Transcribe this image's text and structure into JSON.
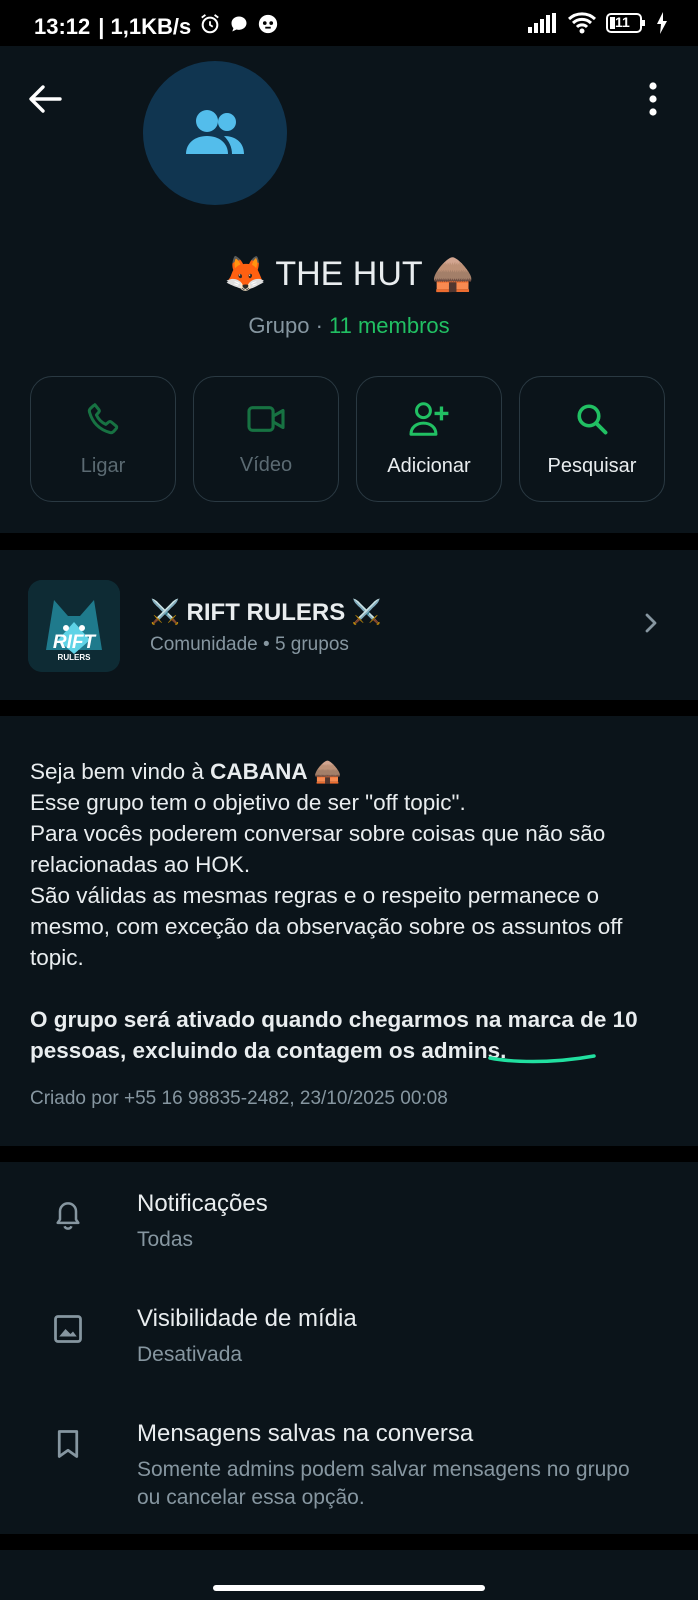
{
  "status_bar": {
    "time": "13:12",
    "speed": "| 1,1KB/s",
    "battery": "11"
  },
  "header": {
    "back_icon": "arrow-left-icon",
    "menu_icon": "more-vertical-icon",
    "avatar_icon": "group-people-icon",
    "title": "🦊 THE HUT 🛖",
    "subtitle_prefix": "Grupo · ",
    "members": "11 membros"
  },
  "actions": [
    {
      "label": "Ligar",
      "icon": "phone-icon",
      "enabled": false
    },
    {
      "label": "Vídeo",
      "icon": "video-icon",
      "enabled": false
    },
    {
      "label": "Adicionar",
      "icon": "add-person-icon",
      "enabled": true
    },
    {
      "label": "Pesquisar",
      "icon": "search-icon",
      "enabled": true
    }
  ],
  "community": {
    "name": "⚔️ RIFT RULERS ⚔️",
    "subtitle": "Comunidade • 5 grupos",
    "logo_text": "RIFT",
    "logo_subtext": "RULERS"
  },
  "description": {
    "line1_prefix": "Seja bem vindo à ",
    "line1_bold": "CABANA",
    "line1_suffix": " 🛖",
    "line2": "Esse grupo tem o objetivo de ser \"off topic\".",
    "line3": "Para vocês poderem conversar sobre coisas que não são relacionadas ao HOK.",
    "line4": "São válidas as mesmas regras e o respeito permanece o mesmo, com exceção da observação sobre os assuntos off topic.",
    "bold_paragraph": "O grupo será ativado quando chegarmos na marca de 10 pessoas, excluindo da contagem os admins.",
    "created": "Criado por +55 16 98835-2482, 23/10/2025 00:08"
  },
  "settings": [
    {
      "title": "Notificações",
      "subtitle": "Todas",
      "icon": "bell-icon"
    },
    {
      "title": "Visibilidade de mídia",
      "subtitle": "Desativada",
      "icon": "image-icon"
    },
    {
      "title": "Mensagens salvas na conversa",
      "subtitle": "Somente admins podem salvar mensagens no grupo ou cancelar essa opção.",
      "icon": "bookmark-icon"
    }
  ],
  "colors": {
    "accent_green": "#21c063",
    "background": "#0b141a",
    "avatar_bg": "#103550",
    "avatar_icon": "#53bdeb"
  }
}
